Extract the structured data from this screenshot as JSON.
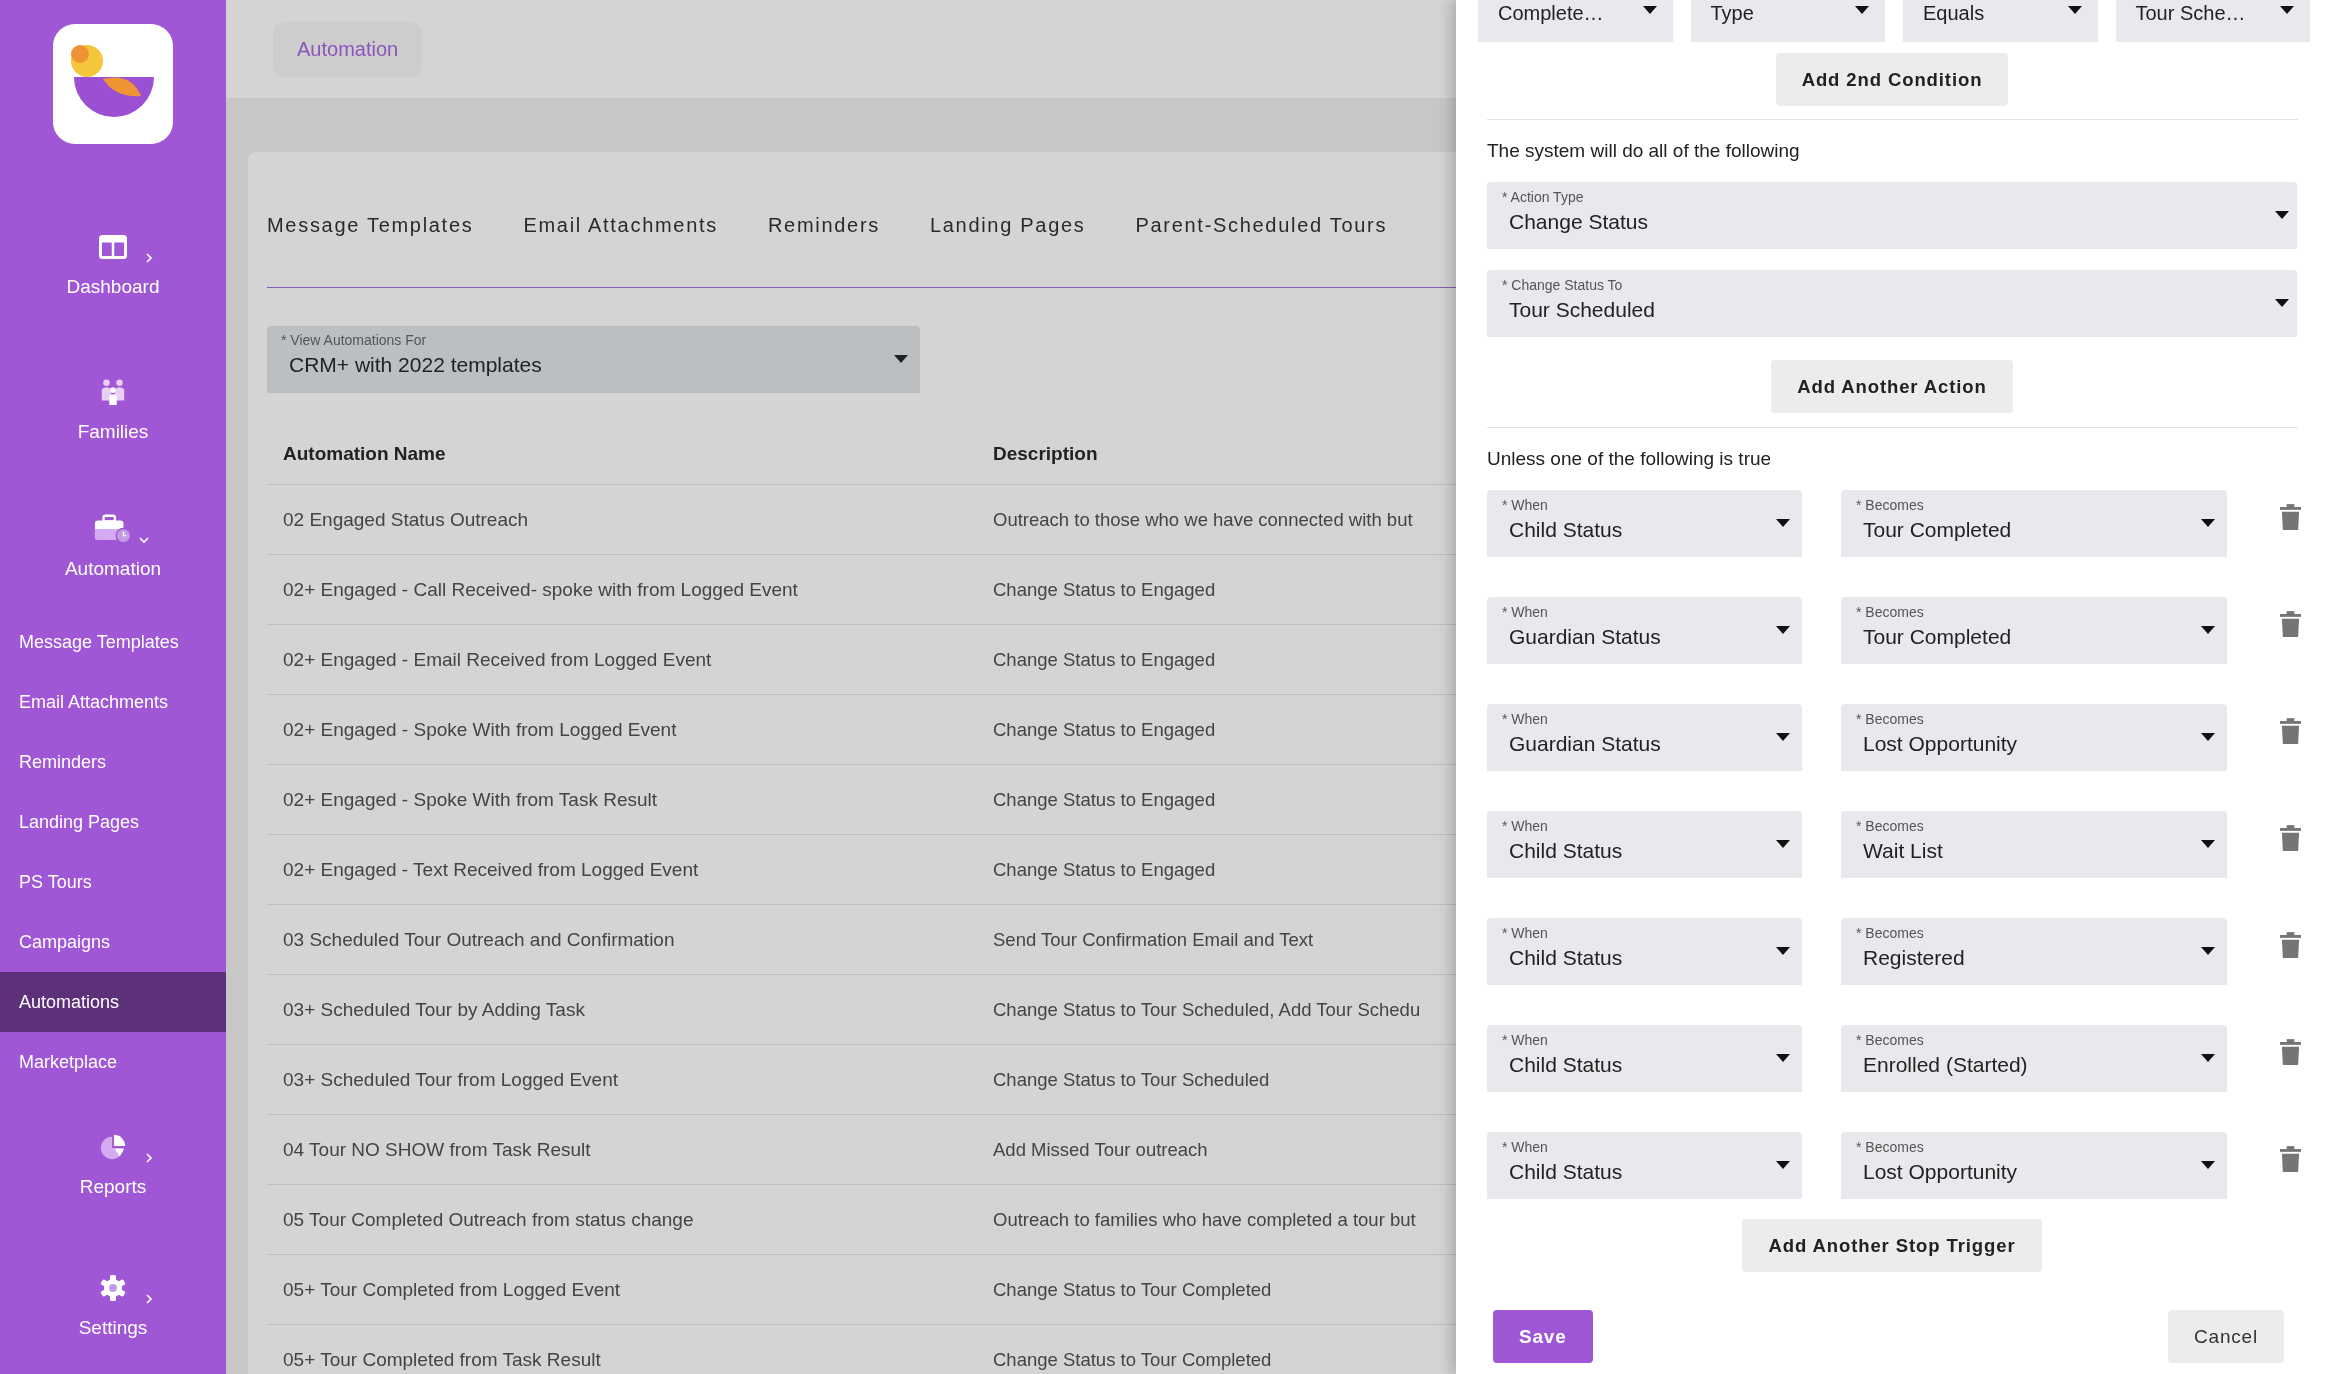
{
  "sidebar": {
    "sections_top": [
      {
        "label": "Dashboard",
        "expanded": false
      },
      {
        "label": "Families"
      },
      {
        "label": "Automation",
        "expanded": true
      }
    ],
    "submenu": [
      {
        "label": "Message Templates",
        "selected": false
      },
      {
        "label": "Email Attachments",
        "selected": false
      },
      {
        "label": "Reminders",
        "selected": false
      },
      {
        "label": "Landing Pages",
        "selected": false
      },
      {
        "label": "PS Tours",
        "selected": false
      },
      {
        "label": "Campaigns",
        "selected": false
      },
      {
        "label": "Automations",
        "selected": true
      },
      {
        "label": "Marketplace",
        "selected": false
      }
    ],
    "sections_bottom": [
      {
        "label": "Reports",
        "expanded": false
      },
      {
        "label": "Settings",
        "expanded": false
      }
    ]
  },
  "breadcrumb": "Automation",
  "tabs": [
    {
      "label": "Message Templates"
    },
    {
      "label": "Email Attachments"
    },
    {
      "label": "Reminders"
    },
    {
      "label": "Landing Pages"
    },
    {
      "label": "Parent-Scheduled Tours"
    }
  ],
  "view_select": {
    "label": "* View Automations For",
    "value": "CRM+ with 2022 templates"
  },
  "table": {
    "columns": [
      "Automation Name",
      "Description"
    ],
    "rows": [
      {
        "name": "02 Engaged Status Outreach",
        "description": "Outreach to those who we have connected with but"
      },
      {
        "name": "02+ Engaged - Call Received- spoke with from Logged Event",
        "description": "Change Status to Engaged"
      },
      {
        "name": "02+ Engaged - Email Received from Logged Event",
        "description": "Change Status to Engaged"
      },
      {
        "name": "02+ Engaged - Spoke With from Logged Event",
        "description": "Change Status to Engaged"
      },
      {
        "name": "02+ Engaged - Spoke With from Task Result",
        "description": "Change Status to Engaged"
      },
      {
        "name": "02+ Engaged - Text Received from Logged Event",
        "description": "Change Status to Engaged"
      },
      {
        "name": "03 Scheduled Tour Outreach and Confirmation",
        "description": "Send Tour Confirmation Email and Text"
      },
      {
        "name": "03+ Scheduled Tour by Adding Task",
        "description": "Change Status to Tour Scheduled, Add Tour Schedu"
      },
      {
        "name": "03+ Scheduled Tour from Logged Event",
        "description": "Change Status to Tour Scheduled"
      },
      {
        "name": "04 Tour NO SHOW from Task Result",
        "description": "Add Missed Tour outreach"
      },
      {
        "name": "05 Tour Completed Outreach from status change",
        "description": "Outreach to families who have completed a tour but"
      },
      {
        "name": "05+ Tour Completed from Logged Event",
        "description": "Change Status to Tour Completed"
      },
      {
        "name": "05+ Tour Completed from Task Result",
        "description": "Change Status to Tour Completed"
      }
    ]
  },
  "panel": {
    "condition_selects": [
      "Complete…",
      "Type",
      "Equals",
      "Tour Sche…"
    ],
    "add_condition_button": "Add 2nd Condition",
    "actions_heading": "The system will do all of the following",
    "actions": [
      {
        "label": "* Action Type",
        "value": "Change Status"
      },
      {
        "label": "* Change Status To",
        "value": "Tour Scheduled"
      }
    ],
    "add_action_button": "Add Another Action",
    "stop_heading": "Unless one of the following is true",
    "stop_triggers": [
      {
        "when_label": "* When",
        "when": "Child Status",
        "becomes_label": "* Becomes",
        "becomes": "Tour Completed"
      },
      {
        "when_label": "* When",
        "when": "Guardian Status",
        "becomes_label": "* Becomes",
        "becomes": "Tour Completed"
      },
      {
        "when_label": "* When",
        "when": "Guardian Status",
        "becomes_label": "* Becomes",
        "becomes": "Lost Opportunity"
      },
      {
        "when_label": "* When",
        "when": "Child Status",
        "becomes_label": "* Becomes",
        "becomes": "Wait List"
      },
      {
        "when_label": "* When",
        "when": "Child Status",
        "becomes_label": "* Becomes",
        "becomes": "Registered"
      },
      {
        "when_label": "* When",
        "when": "Child Status",
        "becomes_label": "* Becomes",
        "becomes": "Enrolled (Started)"
      },
      {
        "when_label": "* When",
        "when": "Child Status",
        "becomes_label": "* Becomes",
        "becomes": "Lost Opportunity"
      }
    ],
    "add_stop_button": "Add Another Stop Trigger",
    "save_button": "Save",
    "cancel_button": "Cancel"
  }
}
